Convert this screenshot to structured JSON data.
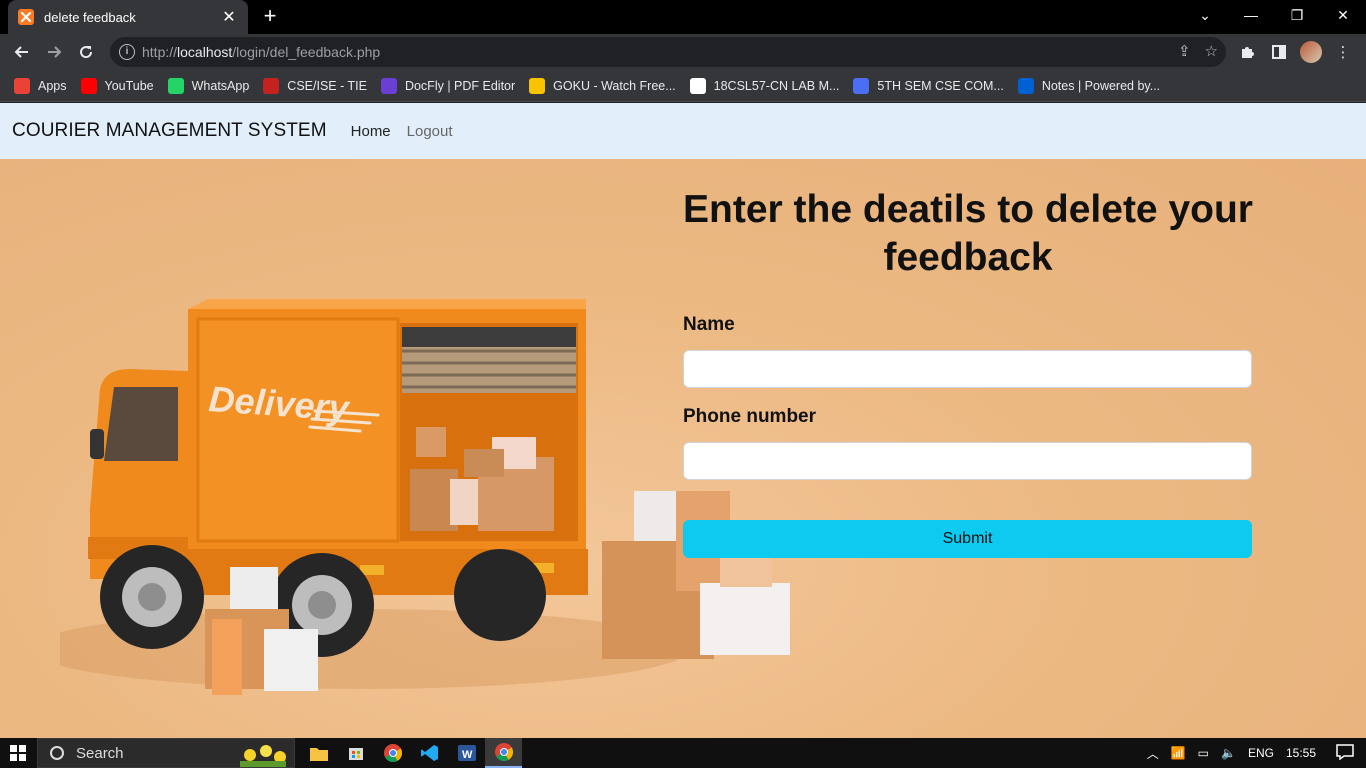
{
  "browser": {
    "tab_title": "delete feedback",
    "tab_favicon": "xampp-icon",
    "url_scheme": "http://",
    "url_host": "localhost",
    "url_path": "/login/del_feedback.php",
    "bookmarks": [
      {
        "label": "Apps",
        "icon": "apps-grid-icon",
        "color": "#ea4335"
      },
      {
        "label": "YouTube",
        "icon": "youtube-icon",
        "color": "#ff0000"
      },
      {
        "label": "WhatsApp",
        "icon": "whatsapp-icon",
        "color": "#25d366"
      },
      {
        "label": "CSE/ISE - TIE",
        "icon": "pdf-icon",
        "color": "#c5221f"
      },
      {
        "label": "DocFly | PDF Editor",
        "icon": "docfly-icon",
        "color": "#6b3fd4"
      },
      {
        "label": "GOKU - Watch Free...",
        "icon": "goku-icon",
        "color": "#f9c300"
      },
      {
        "label": "18CSL57-CN LAB M...",
        "icon": "globe-icon",
        "color": "#ffffff"
      },
      {
        "label": "5TH SEM CSE COM...",
        "icon": "moon-icon",
        "color": "#4c6ef5"
      },
      {
        "label": "Notes | Powered by...",
        "icon": "box-icon",
        "color": "#0061d5"
      }
    ]
  },
  "page": {
    "brand": "COURIER MANAGEMENT SYSTEM",
    "nav": {
      "home": "Home",
      "logout": "Logout"
    },
    "form": {
      "title": "Enter the deatils to delete your feedback",
      "name_label": "Name",
      "name_value": "",
      "phone_label": "Phone number",
      "phone_value": "",
      "submit_label": "Submit"
    },
    "hero_image": {
      "truck_text": "Delivery",
      "accent_color": "#f28a1e"
    }
  },
  "taskbar": {
    "search_placeholder": "Search",
    "language": "ENG",
    "time": "15:55"
  }
}
